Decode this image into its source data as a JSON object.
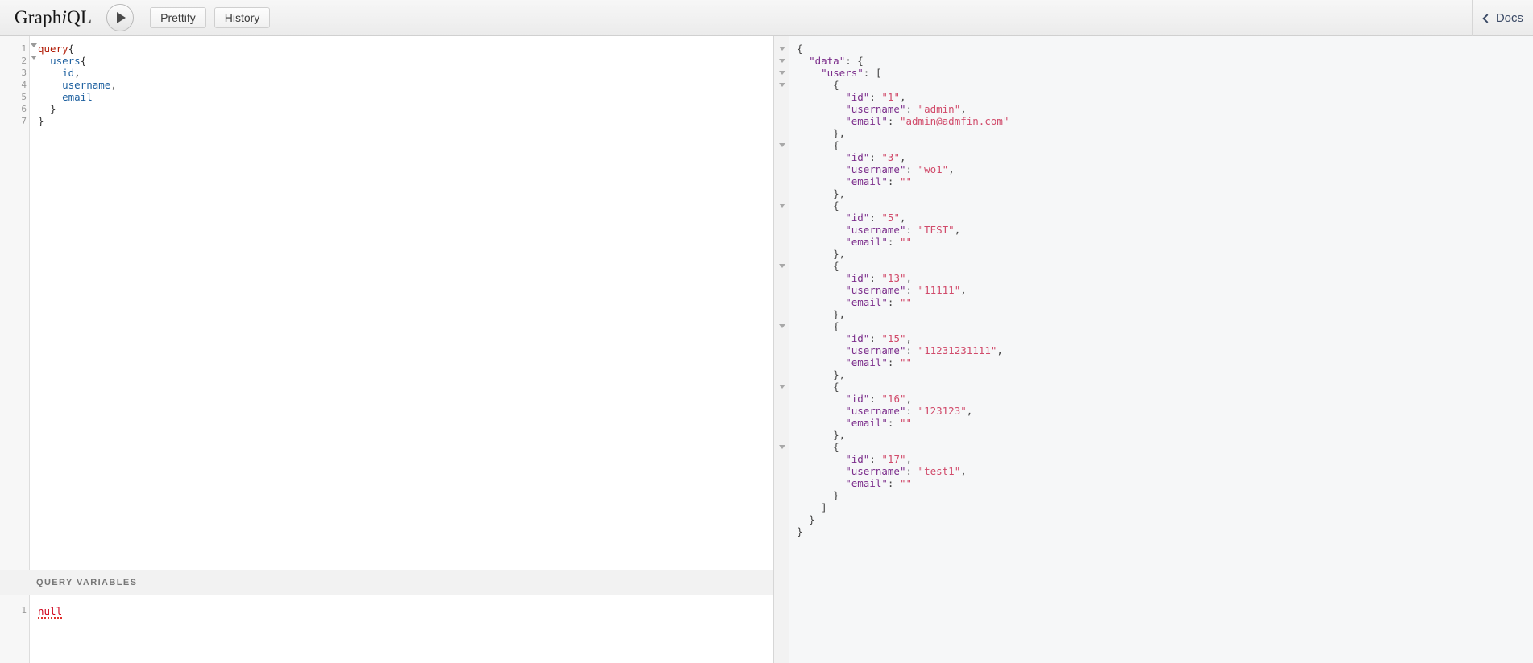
{
  "topbar": {
    "brand_pre": "Graph",
    "brand_i": "i",
    "brand_post": "QL",
    "execute_label": "play-icon",
    "prettify_label": "Prettify",
    "history_label": "History",
    "docs_label": "Docs"
  },
  "query_editor": {
    "lines": [
      {
        "n": "1",
        "fold": true,
        "text": "query{"
      },
      {
        "n": "2",
        "fold": true,
        "text": "  users{"
      },
      {
        "n": "3",
        "fold": false,
        "text": "    id,"
      },
      {
        "n": "4",
        "fold": false,
        "text": "    username,"
      },
      {
        "n": "5",
        "fold": false,
        "text": "    email"
      },
      {
        "n": "6",
        "fold": false,
        "text": "  }"
      },
      {
        "n": "7",
        "fold": false,
        "text": "}"
      }
    ],
    "raw": "query{\n  users{\n    id,\n    username,\n    email\n  }\n}"
  },
  "variables_editor": {
    "header": "QUERY VARIABLES",
    "line_number": "1",
    "value": "null"
  },
  "result_viewer": {
    "lines": [
      {
        "fold": true,
        "text": "{"
      },
      {
        "fold": true,
        "text": "  \"data\": {"
      },
      {
        "fold": true,
        "text": "    \"users\": ["
      },
      {
        "fold": true,
        "text": "      {"
      },
      {
        "fold": false,
        "text": "        \"id\": \"1\","
      },
      {
        "fold": false,
        "text": "        \"username\": \"admin\","
      },
      {
        "fold": false,
        "text": "        \"email\": \"admin@admfin.com\""
      },
      {
        "fold": false,
        "text": "      },"
      },
      {
        "fold": true,
        "text": "      {"
      },
      {
        "fold": false,
        "text": "        \"id\": \"3\","
      },
      {
        "fold": false,
        "text": "        \"username\": \"wo1\","
      },
      {
        "fold": false,
        "text": "        \"email\": \"\""
      },
      {
        "fold": false,
        "text": "      },"
      },
      {
        "fold": true,
        "text": "      {"
      },
      {
        "fold": false,
        "text": "        \"id\": \"5\","
      },
      {
        "fold": false,
        "text": "        \"username\": \"TEST\","
      },
      {
        "fold": false,
        "text": "        \"email\": \"\""
      },
      {
        "fold": false,
        "text": "      },"
      },
      {
        "fold": true,
        "text": "      {"
      },
      {
        "fold": false,
        "text": "        \"id\": \"13\","
      },
      {
        "fold": false,
        "text": "        \"username\": \"11111\","
      },
      {
        "fold": false,
        "text": "        \"email\": \"\""
      },
      {
        "fold": false,
        "text": "      },"
      },
      {
        "fold": true,
        "text": "      {"
      },
      {
        "fold": false,
        "text": "        \"id\": \"15\","
      },
      {
        "fold": false,
        "text": "        \"username\": \"11231231111\","
      },
      {
        "fold": false,
        "text": "        \"email\": \"\""
      },
      {
        "fold": false,
        "text": "      },"
      },
      {
        "fold": true,
        "text": "      {"
      },
      {
        "fold": false,
        "text": "        \"id\": \"16\","
      },
      {
        "fold": false,
        "text": "        \"username\": \"123123\","
      },
      {
        "fold": false,
        "text": "        \"email\": \"\""
      },
      {
        "fold": false,
        "text": "      },"
      },
      {
        "fold": true,
        "text": "      {"
      },
      {
        "fold": false,
        "text": "        \"id\": \"17\","
      },
      {
        "fold": false,
        "text": "        \"username\": \"test1\","
      },
      {
        "fold": false,
        "text": "        \"email\": \"\""
      },
      {
        "fold": false,
        "text": "      }"
      },
      {
        "fold": false,
        "text": "    ]"
      },
      {
        "fold": false,
        "text": "  }"
      },
      {
        "fold": false,
        "text": "}"
      }
    ],
    "users": [
      {
        "id": "1",
        "username": "admin",
        "email": "admin@admfin.com"
      },
      {
        "id": "3",
        "username": "wo1",
        "email": ""
      },
      {
        "id": "5",
        "username": "TEST",
        "email": ""
      },
      {
        "id": "13",
        "username": "11111",
        "email": ""
      },
      {
        "id": "15",
        "username": "11231231111",
        "email": ""
      },
      {
        "id": "16",
        "username": "123123",
        "email": ""
      },
      {
        "id": "17",
        "username": "test1",
        "email": ""
      }
    ]
  },
  "colors": {
    "keyword": "#b11a04",
    "field": "#1f61a0",
    "json_key": "#7b2d8b",
    "json_string": "#d14b6b",
    "error": "#d0021b",
    "docs_link": "#3b4a66"
  }
}
